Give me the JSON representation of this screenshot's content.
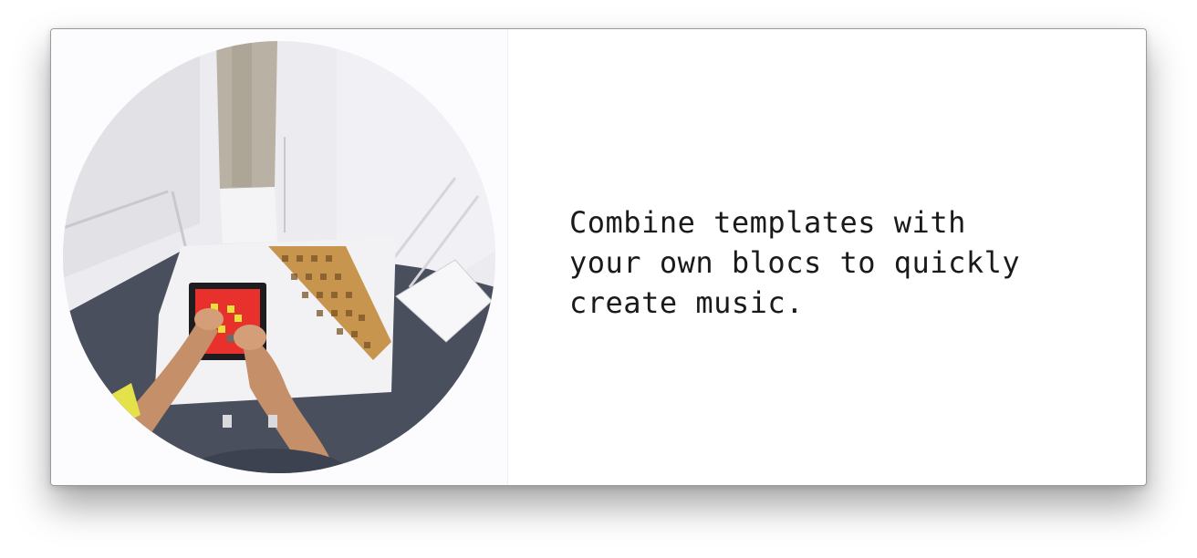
{
  "caption": {
    "text": "Combine templates with\nyour own blocs to quickly\ncreate music."
  },
  "media": {
    "icon": "video-preview-launchpad-performance"
  },
  "colors": {
    "pad_red": "#e8312c",
    "pad_yellow": "#e8e23a",
    "floor": "#4a4f5e",
    "wall": "#e9e7ec"
  }
}
